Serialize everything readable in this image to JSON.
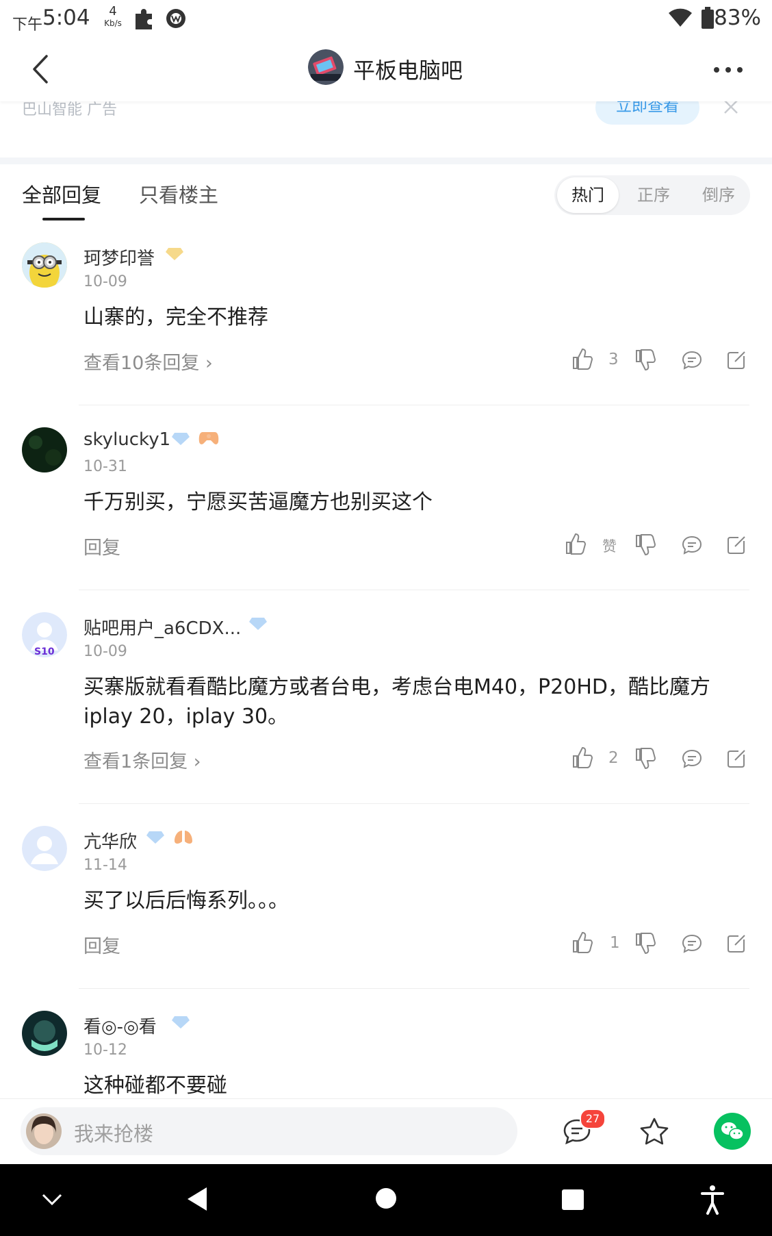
{
  "status_bar": {
    "time_prefix": "下午",
    "time": "5:04",
    "speed_value": "4",
    "speed_unit": "Kb/s",
    "battery": "83%"
  },
  "header": {
    "title": "平板电脑吧"
  },
  "ad": {
    "text": "巴山智能  广告",
    "button": "立即查看"
  },
  "tabs": {
    "all": "全部回复",
    "op_only": "只看楼主"
  },
  "sort": {
    "hot": "热门",
    "asc": "正序",
    "desc": "倒序"
  },
  "comments": [
    {
      "user": "珂梦印誉",
      "date": "10-09",
      "text": "山寨的，完全不推荐",
      "reply_link": "查看10条回复 ›",
      "likes": "3"
    },
    {
      "user": "skylucky1",
      "date": "10-31",
      "text": "千万别买，宁愿买苦逼魔方也别买这个",
      "reply_link": "回复",
      "likes": "赞"
    },
    {
      "user": "贴吧用户_a6CDX...",
      "date": "10-09",
      "text_line1": "买寨版就看看酷比魔方或者台电，考虑台电M40，P20HD，酷比魔方",
      "text_line2": "iplay 20，iplay 30。",
      "reply_link": "查看1条回复 ›",
      "likes": "2",
      "avatar_badge": "S10"
    },
    {
      "user": "亢华欣",
      "date": "11-14",
      "text": "买了以后后悔系列。。。",
      "reply_link": "回复",
      "likes": "1"
    },
    {
      "user": "看◎-◎看",
      "date": "10-12",
      "text": "这种碰都不要碰"
    }
  ],
  "bottom": {
    "input_placeholder": "我来抢楼",
    "comment_badge": "27"
  },
  "colors": {
    "accent": "#3b9be8",
    "wechat": "#07c160",
    "badge": "#f5443b"
  }
}
